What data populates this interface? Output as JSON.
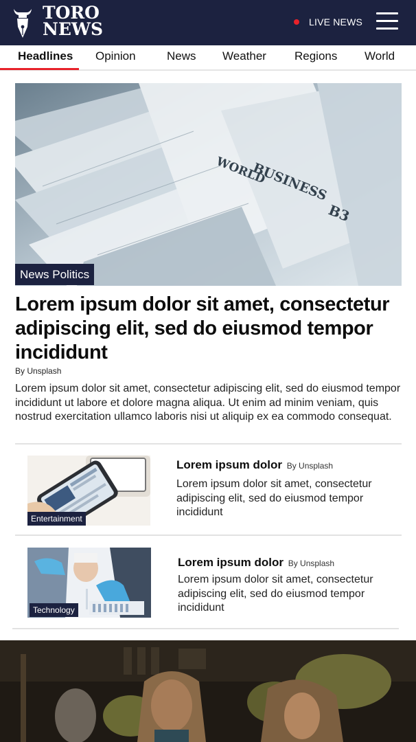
{
  "header": {
    "logo_line1": "TORO",
    "logo_line2": "NEWS",
    "live_label": "LIVE NEWS",
    "colors": {
      "brand_navy": "#1c2240",
      "accent_red": "#e8222a"
    },
    "menu_icon": "hamburger-menu-icon"
  },
  "nav": {
    "items": [
      {
        "label": "Headlines",
        "active": true
      },
      {
        "label": "Opinion"
      },
      {
        "label": "News"
      },
      {
        "label": "Weather"
      },
      {
        "label": "Regions"
      },
      {
        "label": "World"
      }
    ]
  },
  "hero": {
    "tag": "News Politics",
    "title": "Lorem ipsum dolor sit amet, consectetur adipiscing elit, sed do eiusmod tempor incididunt",
    "author": "By Unsplash",
    "excerpt": "Lorem ipsum dolor sit amet, consectetur adipiscing elit, sed do eiusmod tempor incididunt ut labore et dolore magna aliqua. Ut enim ad minim veniam, quis nostrud exercitation ullamco laboris nisi ut aliquip ex ea commodo consequat.",
    "image_text": {
      "world": "WORLD",
      "business": "BUSINESS",
      "page": "B3"
    }
  },
  "articles": [
    {
      "tag": "Entertainment",
      "title": "Lorem ipsum dolor",
      "author": "By Unsplash",
      "excerpt": "Lorem ipsum dolor sit amet, consectetur adipiscing elit, sed do eiusmod tempor incididunt"
    },
    {
      "tag": "Technology",
      "title": "Lorem ipsum dolor",
      "author": "By Unsplash",
      "excerpt": "Lorem ipsum dolor sit amet, consectetur adipiscing elit, sed do eiusmod tempor incididunt"
    }
  ]
}
